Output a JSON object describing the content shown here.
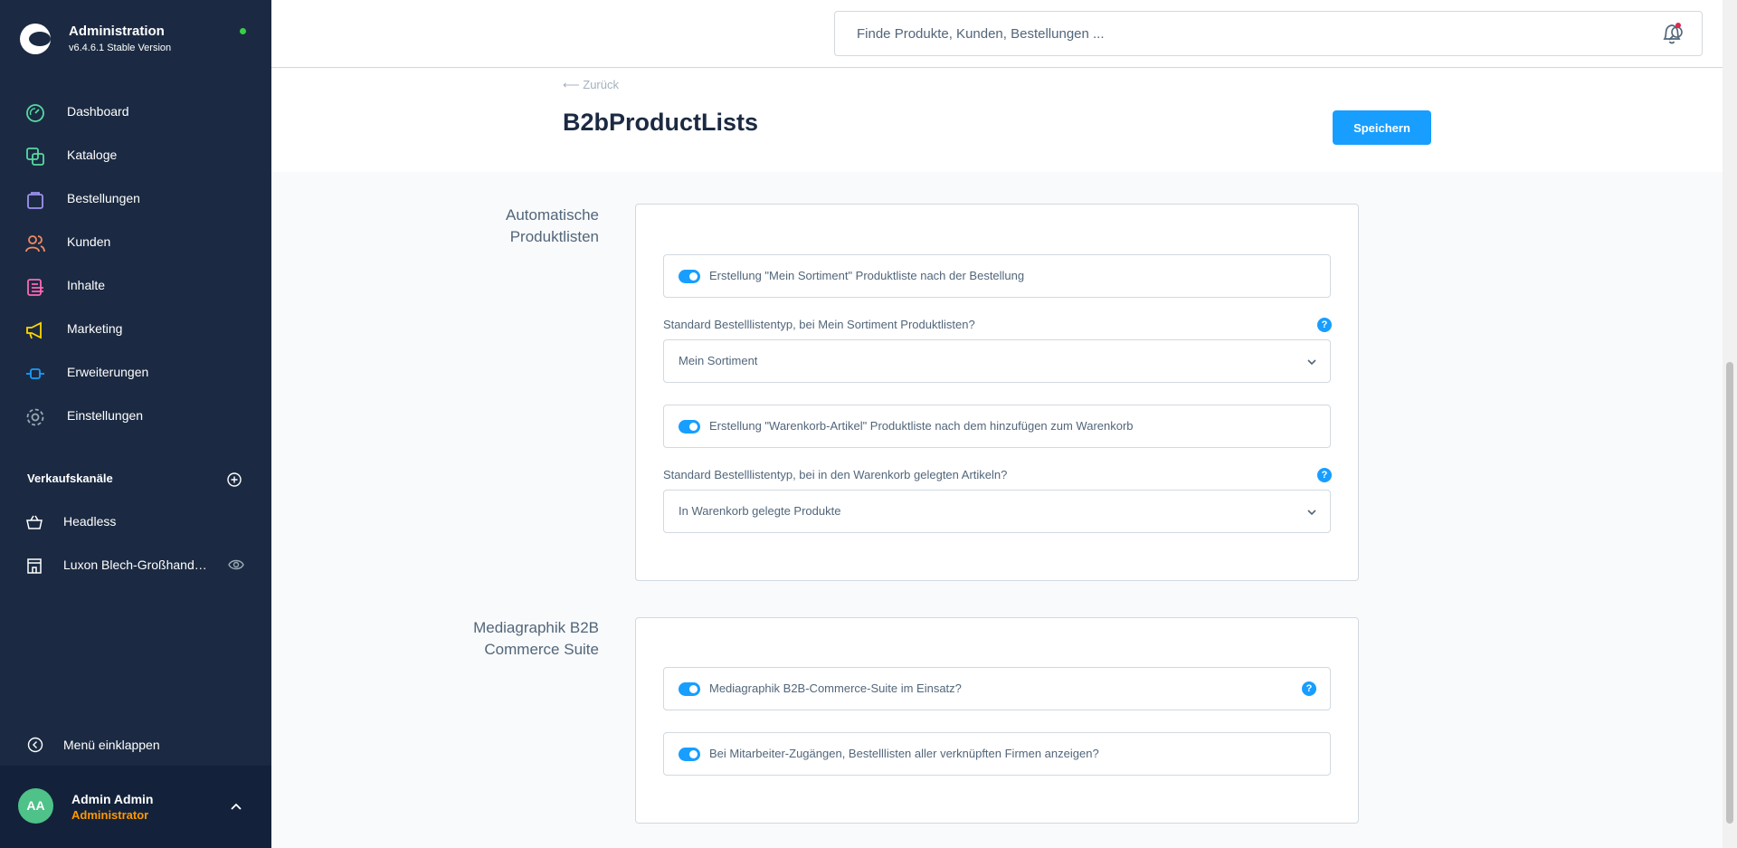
{
  "brand": {
    "title": "Administration",
    "version": "v6.4.6.1 Stable Version"
  },
  "nav": [
    {
      "label": "Dashboard",
      "icon": "dashboard-icon",
      "color": "#57d9a3"
    },
    {
      "label": "Kataloge",
      "icon": "catalog-icon",
      "color": "#57d9a3"
    },
    {
      "label": "Bestellungen",
      "icon": "orders-icon",
      "color": "#a092f0"
    },
    {
      "label": "Kunden",
      "icon": "customers-icon",
      "color": "#f88962"
    },
    {
      "label": "Inhalte",
      "icon": "content-icon",
      "color": "#ff68b4"
    },
    {
      "label": "Marketing",
      "icon": "marketing-icon",
      "color": "#ffd700"
    },
    {
      "label": "Erweiterungen",
      "icon": "extensions-icon",
      "color": "#189eff"
    },
    {
      "label": "Einstellungen",
      "icon": "settings-icon",
      "color": "#9aa8b5"
    }
  ],
  "sales_channels": {
    "title": "Verkaufskanäle",
    "items": [
      {
        "label": "Headless",
        "icon": "basket-icon"
      },
      {
        "label": "Luxon Blech-Großhandel GmbH",
        "icon": "storefront-icon"
      }
    ]
  },
  "collapse_label": "Menü einklappen",
  "user": {
    "initials": "AA",
    "name": "Admin Admin",
    "role": "Administrator"
  },
  "search": {
    "placeholder": "Finde Produkte, Kunden, Bestellungen ..."
  },
  "header": {
    "back_label": "Zurück",
    "title": "B2bProductLists",
    "save_label": "Speichern"
  },
  "groups": {
    "auto": {
      "label_line1": "Automatische",
      "label_line2": "Produktlisten",
      "toggle1": "Erstellung \"Mein Sortiment\" Produktliste nach der Bestellung",
      "field1_label": "Standard Bestelllistentyp, bei Mein Sortiment Produktlisten?",
      "field1_value": "Mein Sortiment",
      "toggle2": "Erstellung \"Warenkorb-Artikel\" Produktliste nach dem hinzufügen zum Warenkorb",
      "field2_label": "Standard Bestelllistentyp, bei in den Warenkorb gelegten Artikeln?",
      "field2_value": "In Warenkorb gelegte Produkte"
    },
    "suite": {
      "label_line1": "Mediagraphik B2B",
      "label_line2": "Commerce Suite",
      "toggle1": "Mediagraphik B2B-Commerce-Suite im Einsatz?",
      "toggle2": "Bei Mitarbeiter-Zugängen, Bestelllisten aller verknüpften Firmen anzeigen?"
    }
  },
  "help_glyph": "?"
}
